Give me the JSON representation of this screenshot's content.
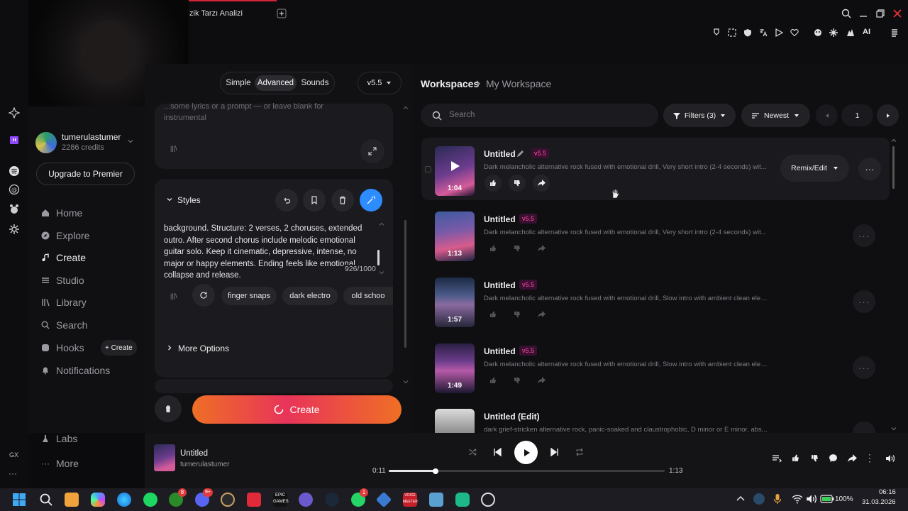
{
  "browser": {
    "tab_title": "zik Tarzı Analizi",
    "new_tab_icon": "plus-icon",
    "toolbar_ai_label": "AI"
  },
  "rail": {
    "label_gx": "GX",
    "more": "···"
  },
  "sidebar": {
    "username": "tumerulastumer",
    "credits": "2286 credits",
    "upgrade_label": "Upgrade to Premier",
    "items": [
      {
        "label": "Home",
        "icon": "home-icon"
      },
      {
        "label": "Explore",
        "icon": "compass-icon"
      },
      {
        "label": "Create",
        "icon": "music-note-icon",
        "active": true
      },
      {
        "label": "Studio",
        "icon": "studio-icon"
      },
      {
        "label": "Library",
        "icon": "library-icon"
      },
      {
        "label": "Search",
        "icon": "search-icon"
      },
      {
        "label": "Hooks",
        "icon": "hooks-icon"
      },
      {
        "label": "Notifications",
        "icon": "bell-icon"
      }
    ],
    "hooks_create": "+ Create",
    "labs": "Labs",
    "more": "More"
  },
  "create_panel": {
    "modes": [
      "Simple",
      "Advanced",
      "Sounds"
    ],
    "active_mode": "Advanced",
    "version": "v5.5",
    "lyrics_placeholder": "...some lyrics or a prompt — or leave blank for instrumental",
    "styles_label": "Styles",
    "styles_text": "background. Structure: 2 verses, 2 choruses, extended outro. After second chorus include melodic emotional guitar solo. Keep it cinematic, depressive, intense, no major or happy elements. Ending feels like emotional collapse and release.",
    "char_count": "926/1000",
    "style_tags": [
      "finger snaps",
      "dark electro",
      "old schoo"
    ],
    "more_options": "More Options",
    "create_label": "Create"
  },
  "workspace": {
    "breadcrumb_root": "Workspaces",
    "breadcrumb_current": "My Workspace",
    "search_placeholder": "Search",
    "filters_label": "Filters (3)",
    "sort_label": "Newest",
    "page": "1",
    "remix_label": "Remix/Edit",
    "songs": [
      {
        "title": "Untitled",
        "version": "v5.5",
        "duration": "1:04",
        "desc": "Dark melancholic alternative rock fused with emotional drill, Very short intro (2-4 seconds) wit..."
      },
      {
        "title": "Untitled",
        "version": "v5.5",
        "duration": "1:13",
        "desc": "Dark melancholic alternative rock fused with emotional drill, Very short intro (2-4 seconds) wit..."
      },
      {
        "title": "Untitled",
        "version": "v5.5",
        "duration": "1:57",
        "desc": "Dark melancholic alternative rock fused with emotional drill, Slow intro with ambient clean elec..."
      },
      {
        "title": "Untitled",
        "version": "v5.5",
        "duration": "1:49",
        "desc": "Dark melancholic alternative rock fused with emotional drill, Slow intro with ambient clean elec..."
      },
      {
        "title": "Untitled (Edit)",
        "version": "",
        "duration": "",
        "desc": "dark grief-stricken alternative rock, panic-soaked and claustrophobic, D minor or E minor, abs..."
      }
    ]
  },
  "player": {
    "title": "Untitled",
    "artist": "tumerulastumer",
    "elapsed": "0:11",
    "total": "1:13",
    "progress": 0.17
  },
  "taskbar": {
    "battery": "100%",
    "time": "06:16",
    "date": "31.03.2026",
    "badge_xbox": "8",
    "badge_discord": "9+",
    "badge_whatsapp": "1",
    "voicemeeter_label": "VOICE MEETER",
    "epic_label": "EPIC GAMES"
  },
  "colors": {
    "accent_blue": "#2d8cff",
    "version_pink": "#ff4fa3",
    "create_gradient_start": "#f06a2a",
    "create_gradient_end": "#e8345a",
    "tab_accent": "#d8223a"
  }
}
